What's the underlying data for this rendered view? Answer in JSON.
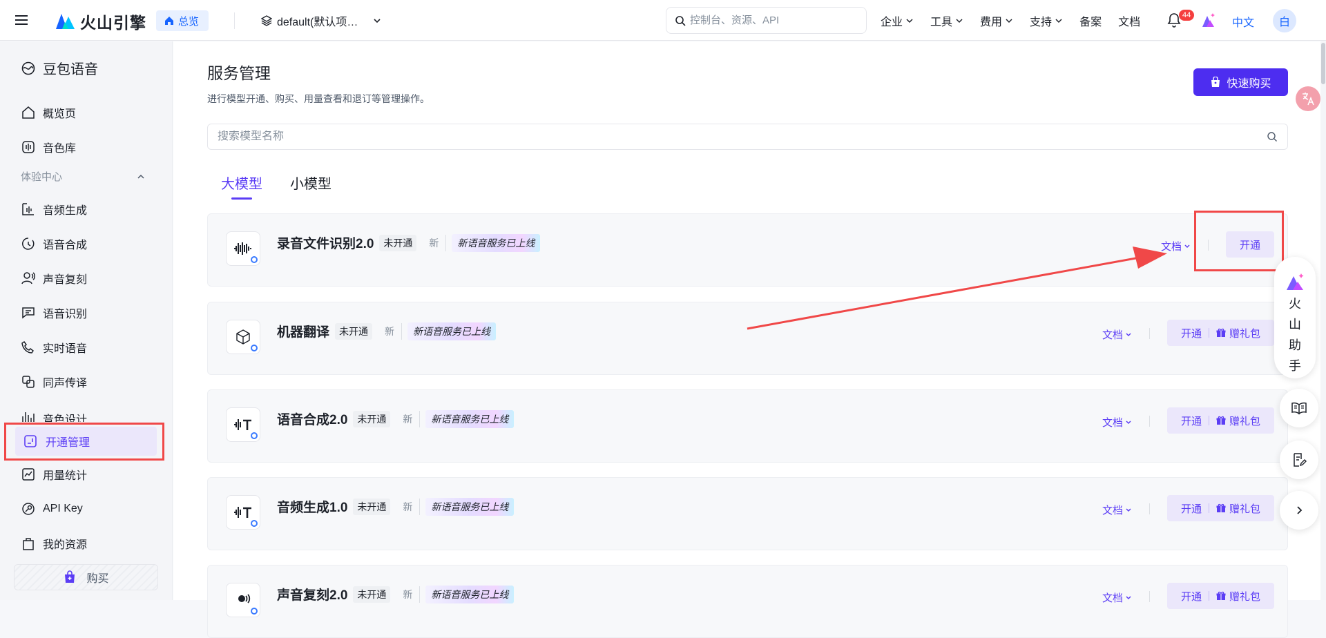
{
  "topbar": {
    "logo_text": "火山引擎",
    "home_label": "总览",
    "project_label": "default(默认项…",
    "search_placeholder": "控制台、资源、API",
    "nav": [
      "企业",
      "工具",
      "费用",
      "支持",
      "备案",
      "文档"
    ],
    "notification_count": "44",
    "language": "中文",
    "avatar_text": "白"
  },
  "sidebar": {
    "title": "豆包语音",
    "items": {
      "overview": "概览页",
      "voice_library": "音色库",
      "audio_gen": "音频生成",
      "tts": "语音合成",
      "voice_clone": "声音复刻",
      "asr": "语音识别",
      "realtime": "实时语音",
      "simul": "同声传译",
      "voice_design": "音色设计",
      "activation": "开通管理",
      "usage": "用量统计",
      "api_key": "API Key",
      "resources": "我的资源"
    },
    "group_label": "体验中心",
    "buy_label": "购买"
  },
  "main": {
    "title": "服务管理",
    "subtitle": "进行模型开通、购买、用量查看和退订等管理操作。",
    "quick_buy": "快速购买",
    "search_placeholder": "搜索模型名称",
    "tabs": [
      "大模型",
      "小模型"
    ],
    "tag_new": "新",
    "tag_online": "新语音服务已上线",
    "doc_label": "文档",
    "open_label": "开通",
    "gift_label": "赠礼包",
    "cards": [
      {
        "name": "录音文件识别2.0",
        "status": "未开通",
        "icon": "waveform-icon"
      },
      {
        "name": "机器翻译",
        "status": "未开通",
        "icon": "cube-icon"
      },
      {
        "name": "语音合成2.0",
        "status": "未开通",
        "icon": "wave-t-icon"
      },
      {
        "name": "音频生成1.0",
        "status": "未开通",
        "icon": "wave-t-icon"
      },
      {
        "name": "声音复刻2.0",
        "status": "未开通",
        "icon": "voice-icon"
      }
    ]
  },
  "assistant": {
    "chars": [
      "火",
      "山",
      "助",
      "手"
    ]
  },
  "colors": {
    "accent": "#5b3df5",
    "brand_blue": "#1664ff",
    "highlight_red": "#f04848"
  }
}
